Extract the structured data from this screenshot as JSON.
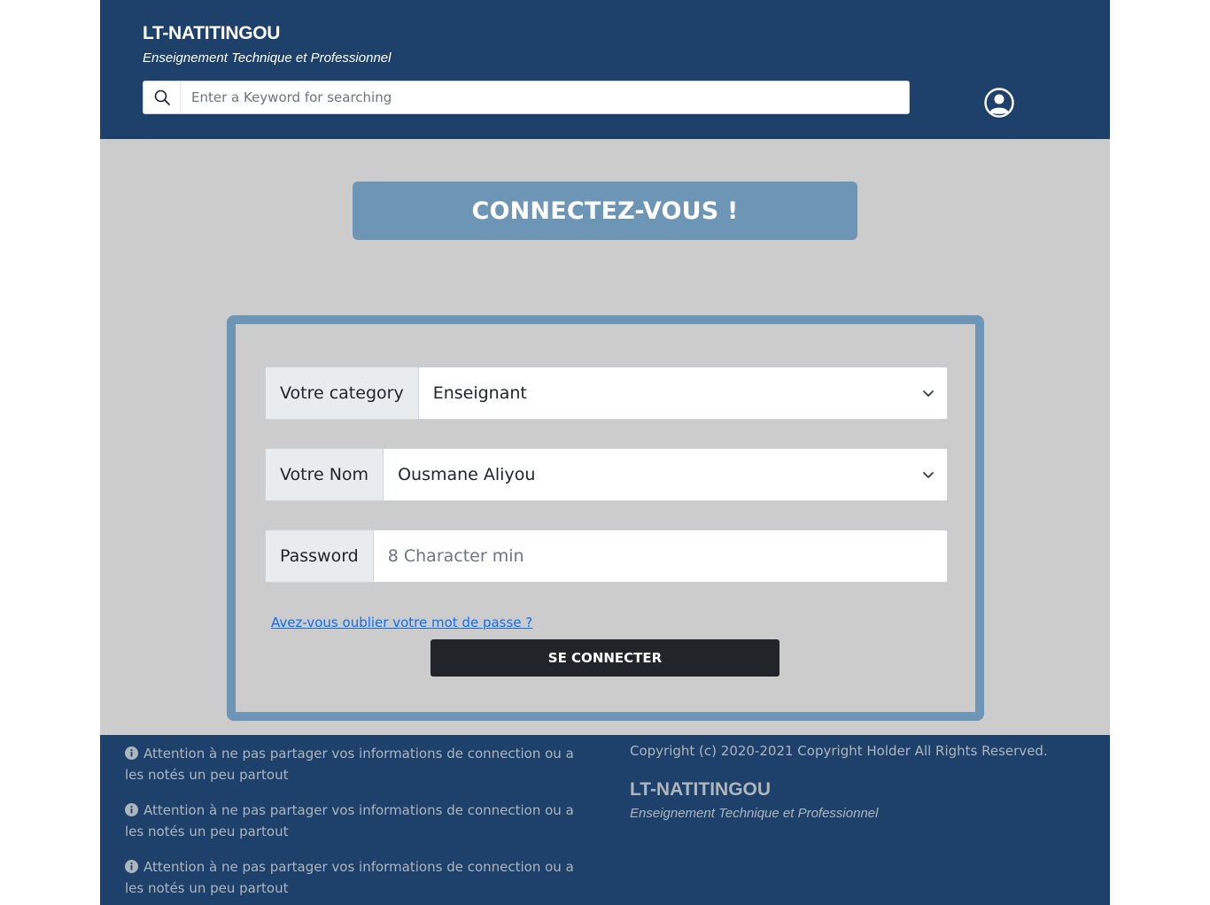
{
  "header": {
    "brand_title": "LT-NATITINGOU",
    "brand_subtitle": "Enseignement Technique et Professionnel",
    "search_placeholder": "Enter a Keyword for searching",
    "search_icon": "search-icon",
    "user_icon": "user-circle-icon"
  },
  "banner": {
    "title": "CONNECTEZ-VOUS !"
  },
  "form": {
    "category": {
      "label": "Votre category",
      "value": "Enseignant"
    },
    "name": {
      "label": "Votre Nom",
      "value": "Ousmane Aliyou"
    },
    "password": {
      "label": "Password",
      "placeholder": "8 Character min"
    },
    "forgot_link": "Avez-vous oublier votre mot de passe ?",
    "submit_label": "SE CONNECTER"
  },
  "footer": {
    "notes": [
      "Attention à ne pas partager vos informations de connection ou a les notés un peu partout",
      "Attention à ne pas partager vos informations de connection ou a les notés un peu partout",
      "Attention à ne pas partager vos informations de connection ou a les notés un peu partout"
    ],
    "copyright": "Copyright (c) 2020-2021 Copyright Holder All Rights Reserved.",
    "brand_title": "LT-NATITINGOU",
    "brand_subtitle": "Enseignement Technique et Professionnel"
  },
  "colors": {
    "header_bg": "#1d416a",
    "page_bg": "#cccccc",
    "accent": "#6d95b6",
    "button_bg": "#212529",
    "link": "#0d6efd"
  }
}
